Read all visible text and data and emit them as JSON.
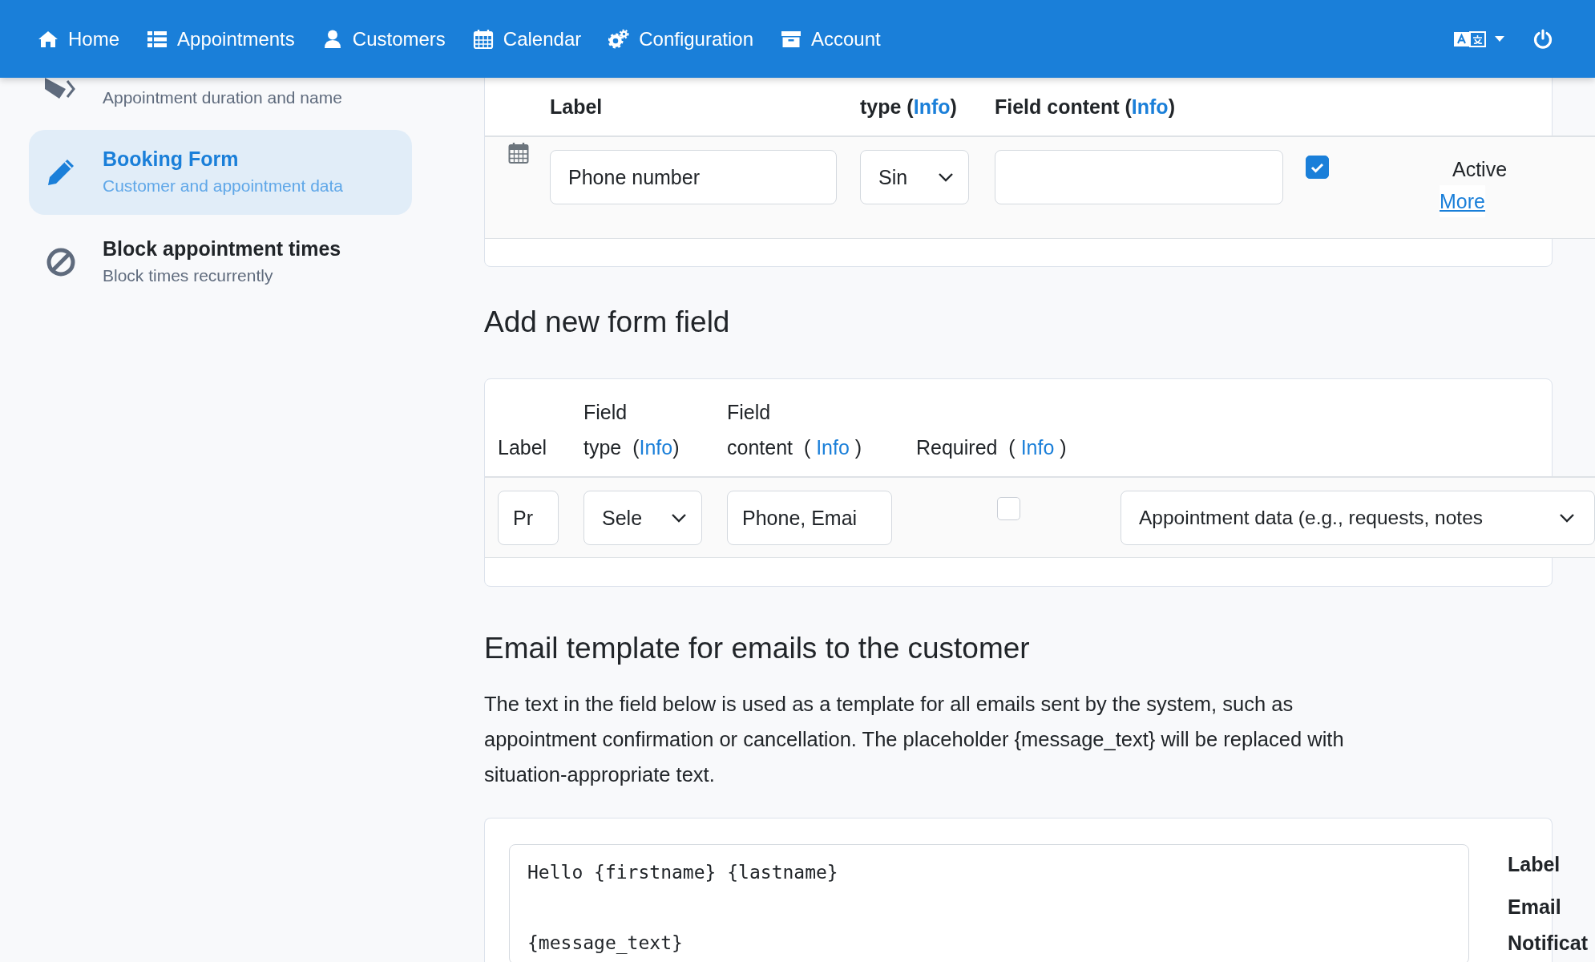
{
  "navbar": {
    "items": [
      {
        "label": "Home"
      },
      {
        "label": "Appointments"
      },
      {
        "label": "Customers"
      },
      {
        "label": "Calendar"
      },
      {
        "label": "Configuration"
      },
      {
        "label": "Account"
      }
    ]
  },
  "sidebar": {
    "items": [
      {
        "subtitle": "Appointment duration and name",
        "selected": false
      },
      {
        "title": "Booking Form",
        "subtitle": "Customer and appointment data",
        "selected": true
      },
      {
        "title": "Block appointment times",
        "subtitle": "Block times recurrently",
        "selected": false
      }
    ]
  },
  "form_fields": {
    "columns": [
      {
        "before": "Label"
      },
      {
        "before": "type (",
        "link": "Info",
        "after": ")"
      },
      {
        "before": "Field content (",
        "link": "Info",
        "after": ")"
      }
    ],
    "rows": [
      {
        "label": "Phone number",
        "field_type": "Sin",
        "active": true,
        "status": "Active",
        "link": "More"
      }
    ]
  },
  "new_field": {
    "heading": "Add new form field",
    "columns": [
      {
        "before": "Label"
      },
      {
        "before": "Field\ntype  (",
        "link": "Info",
        "after": ")"
      },
      {
        "before": "Field\ncontent  ( ",
        "link": "Info",
        "after": " )"
      },
      {
        "before": "Required  ( ",
        "link": "Info",
        "after": " )"
      }
    ],
    "label": "Pr",
    "field_type": "Sele",
    "field_content": "Phone, Emai",
    "required": false,
    "category": "Appointment data (e.g., requests, notes"
  },
  "email_template": {
    "heading": "Email template for emails to the customer",
    "description": "The text in the field below is used as a template for all emails sent by the system, such as appointment confirmation or cancellation. The placeholder {message_text} will be replaced with situation-appropriate text.",
    "template": "Hello {firstname} {lastname}\n\n{message_text}",
    "side_labels": [
      "Label",
      "Email Notificat"
    ]
  }
}
